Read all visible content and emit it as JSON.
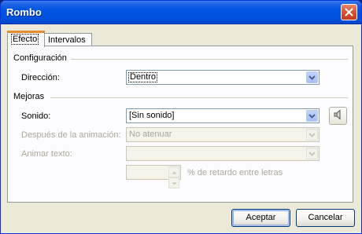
{
  "window": {
    "title": "Rombo"
  },
  "tabs": [
    {
      "label": "Efecto"
    },
    {
      "label": "Intervalos"
    }
  ],
  "config": {
    "group_label": "Configuración",
    "direction_label": "Dirección:",
    "direction_value": "Dentro"
  },
  "enhancements": {
    "group_label": "Mejoras",
    "sound_label": "Sonido:",
    "sound_value": "[Sin sonido]",
    "after_anim_label": "Después de la animación:",
    "after_anim_value": "No atenuar",
    "animate_text_label": "Animar texto:",
    "animate_text_value": "",
    "delay_suffix": "% de retardo entre letras",
    "delay_value": ""
  },
  "buttons": {
    "ok": "Aceptar",
    "cancel": "Cancelar"
  },
  "icons": {
    "close": "close-icon",
    "speaker": "speaker-icon",
    "dropdown": "chevron-down-icon"
  },
  "colors": {
    "titlebar": "#0054e3",
    "active_tab_accent": "#e68b2c",
    "dialog_bg": "#ece9d8"
  }
}
